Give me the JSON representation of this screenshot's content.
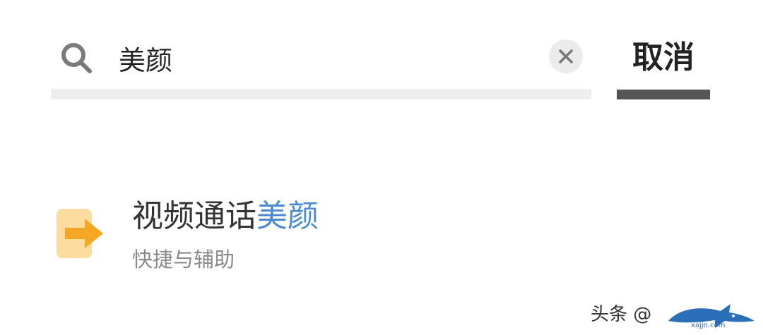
{
  "search": {
    "query": "美颜",
    "clear_icon": "close-icon",
    "search_icon": "search-icon",
    "cancel_label": "取消"
  },
  "results": [
    {
      "icon": "arrow-right-icon",
      "icon_color": "#f5a623",
      "title_prefix": "视频通话",
      "title_match": "美颜",
      "subtitle": "快捷与辅助"
    }
  ],
  "watermark": {
    "text": "头条 @",
    "logo": "shark-logo",
    "logo_text": "xajjn.com"
  },
  "colors": {
    "highlight": "#4a8bd0",
    "active_tab": "#555555"
  }
}
